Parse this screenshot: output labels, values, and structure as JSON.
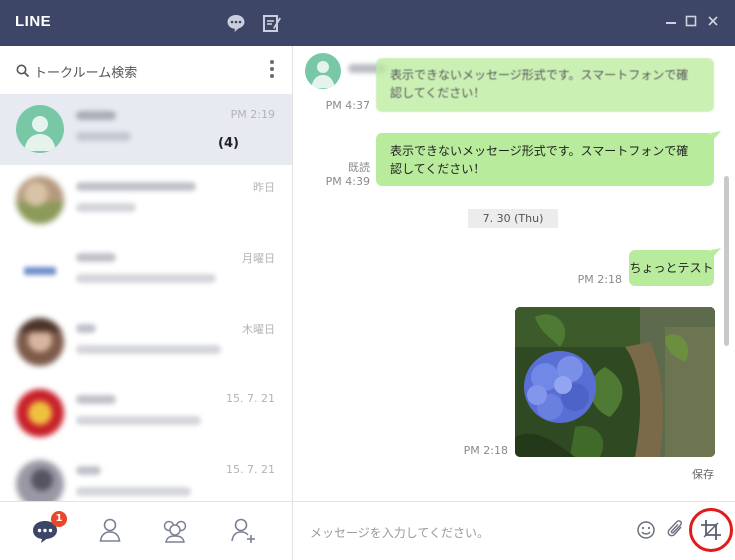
{
  "app": {
    "title": "LINE"
  },
  "search": {
    "placeholder": "トークルーム検索"
  },
  "chats": [
    {
      "time": "PM 2:19"
    },
    {
      "time": "昨日",
      "unread": "(4)"
    },
    {
      "time": "月曜日"
    },
    {
      "time": "木曜日"
    },
    {
      "time": "15. 7. 21"
    },
    {
      "time": "15. 7. 21"
    }
  ],
  "nav": {
    "notification_count": "1"
  },
  "messages": {
    "msg1": {
      "text": "表示できないメッセージ形式です。スマートフォンで確認してください！",
      "time": "PM 4:37"
    },
    "msg2": {
      "text": "表示できないメッセージ形式です。スマートフォンで確認してください！",
      "read": "既読",
      "time": "PM 4:39"
    },
    "date_chip": "7. 30 (Thu)",
    "msg3": {
      "text": "ちょっとテスト",
      "time": "PM 2:18"
    },
    "photo": {
      "time": "PM 2:18",
      "save_label": "保存"
    }
  },
  "input": {
    "placeholder": "メッセージを入力してください。"
  },
  "colors": {
    "titlebar": "#3d4666",
    "bubble": "#b9eb9c",
    "badge": "#e8472a",
    "highlight": "#e11a1a"
  }
}
